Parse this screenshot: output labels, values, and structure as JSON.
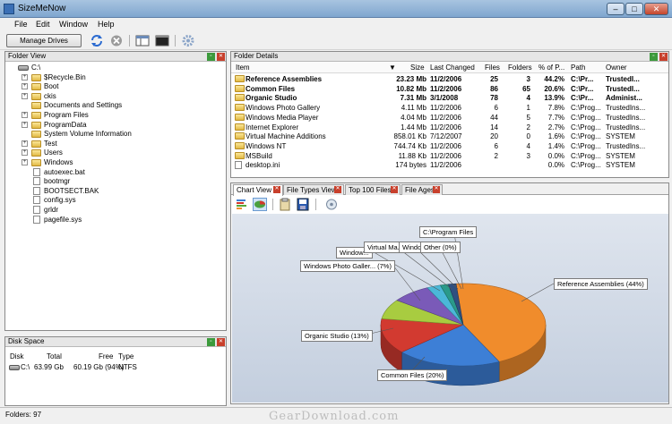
{
  "window": {
    "title": "SizeMeNow",
    "min_glyph": "–",
    "max_glyph": "□",
    "close_glyph": "✕"
  },
  "menu": [
    "File",
    "Edit",
    "Window",
    "Help"
  ],
  "toolbar": {
    "manage_drives": "Manage Drives"
  },
  "folder_view": {
    "title": "Folder View",
    "root": "C:\\",
    "items": [
      {
        "label": "$Recycle.Bin",
        "type": "folder",
        "expandable": true
      },
      {
        "label": "Boot",
        "type": "folder",
        "expandable": true
      },
      {
        "label": "ckis",
        "type": "folder",
        "expandable": true
      },
      {
        "label": "Documents and Settings",
        "type": "folder",
        "expandable": false
      },
      {
        "label": "Program Files",
        "type": "folder",
        "expandable": true
      },
      {
        "label": "ProgramData",
        "type": "folder",
        "expandable": true
      },
      {
        "label": "System Volume Information",
        "type": "folder",
        "expandable": false
      },
      {
        "label": "Test",
        "type": "folder",
        "expandable": true
      },
      {
        "label": "Users",
        "type": "folder",
        "expandable": true
      },
      {
        "label": "Windows",
        "type": "folder",
        "expandable": true
      },
      {
        "label": "autoexec.bat",
        "type": "file",
        "expandable": false
      },
      {
        "label": "bootmgr",
        "type": "file",
        "expandable": false
      },
      {
        "label": "BOOTSECT.BAK",
        "type": "file",
        "expandable": false
      },
      {
        "label": "config.sys",
        "type": "file",
        "expandable": false
      },
      {
        "label": "grldr",
        "type": "file",
        "expandable": false
      },
      {
        "label": "pagefile.sys",
        "type": "file",
        "expandable": false
      }
    ]
  },
  "disk_space": {
    "title": "Disk Space",
    "columns": [
      "Disk",
      "Total",
      "Free",
      "Type"
    ],
    "rows": [
      {
        "disk": "C:\\",
        "total": "63.99 Gb",
        "free": "60.19 Gb (94%)",
        "type": "NTFS"
      }
    ]
  },
  "folder_details": {
    "title": "Folder Details",
    "sort_glyph": "▼",
    "columns": [
      "Item",
      "Size",
      "Last Changed",
      "Files",
      "Folders",
      "% of P...",
      "Path",
      "Owner"
    ],
    "rows": [
      {
        "item": "Reference Assemblies",
        "size": "23.23 Mb",
        "changed": "11/2/2006",
        "files": "25",
        "folders": "3",
        "pct": "44.2%",
        "path": "C:\\Pr...",
        "owner": "TrustedI...",
        "bold": true
      },
      {
        "item": "Common Files",
        "size": "10.82 Mb",
        "changed": "11/2/2006",
        "files": "86",
        "folders": "65",
        "pct": "20.6%",
        "path": "C:\\Pr...",
        "owner": "TrustedI...",
        "bold": true
      },
      {
        "item": "Organic Studio",
        "size": "7.31 Mb",
        "changed": "3/1/2008",
        "files": "78",
        "folders": "4",
        "pct": "13.9%",
        "path": "C:\\Pr...",
        "owner": "Administ...",
        "bold": true
      },
      {
        "item": "Windows Photo Gallery",
        "size": "4.11 Mb",
        "changed": "11/2/2006",
        "files": "6",
        "folders": "1",
        "pct": "7.8%",
        "path": "C:\\Prog...",
        "owner": "TrustedIns...",
        "bold": false
      },
      {
        "item": "Windows Media Player",
        "size": "4.04 Mb",
        "changed": "11/2/2006",
        "files": "44",
        "folders": "5",
        "pct": "7.7%",
        "path": "C:\\Prog...",
        "owner": "TrustedIns...",
        "bold": false
      },
      {
        "item": "Internet Explorer",
        "size": "1.44 Mb",
        "changed": "11/2/2006",
        "files": "14",
        "folders": "2",
        "pct": "2.7%",
        "path": "C:\\Prog...",
        "owner": "TrustedIns...",
        "bold": false
      },
      {
        "item": "Virtual Machine Additions",
        "size": "858.01 Kb",
        "changed": "7/12/2007",
        "files": "20",
        "folders": "0",
        "pct": "1.6%",
        "path": "C:\\Prog...",
        "owner": "SYSTEM",
        "bold": false
      },
      {
        "item": "Windows NT",
        "size": "744.74 Kb",
        "changed": "11/2/2006",
        "files": "6",
        "folders": "4",
        "pct": "1.4%",
        "path": "C:\\Prog...",
        "owner": "TrustedIns...",
        "bold": false
      },
      {
        "item": "MSBuild",
        "size": "11.88 Kb",
        "changed": "11/2/2006",
        "files": "2",
        "folders": "3",
        "pct": "0.0%",
        "path": "C:\\Prog...",
        "owner": "SYSTEM",
        "bold": false
      },
      {
        "item": "desktop.ini",
        "size": "174 bytes",
        "changed": "11/2/2006",
        "files": "",
        "folders": "",
        "pct": "0.0%",
        "path": "C:\\Prog...",
        "owner": "SYSTEM",
        "bold": false,
        "file": true
      }
    ]
  },
  "tabs": [
    {
      "label": "Chart View",
      "active": true
    },
    {
      "label": "File Types View",
      "active": false
    },
    {
      "label": "Top 100 Files",
      "active": false
    },
    {
      "label": "File Ages",
      "active": false
    }
  ],
  "chart_data": {
    "type": "pie",
    "slices": [
      {
        "label": "Reference Assemblies (44%)",
        "value": 44.2,
        "color": "#f08c2c"
      },
      {
        "label": "Common Files (20%)",
        "value": 20.6,
        "color": "#3d7fd6"
      },
      {
        "label": "Organic Studio (13%)",
        "value": 13.9,
        "color": "#d23a30"
      },
      {
        "label": "Windows Photo Galler... (7%)",
        "value": 7.8,
        "color": "#a8cc40"
      },
      {
        "label": "Window...",
        "value": 7.7,
        "color": "#7a5ab8"
      },
      {
        "label": "Virtual Ma...",
        "value": 2.7,
        "color": "#4bb8d8"
      },
      {
        "label": "Windo...",
        "value": 1.6,
        "color": "#2a9a8a"
      },
      {
        "label": "Other (0%)",
        "value": 1.5,
        "color": "#305080"
      }
    ],
    "top_label": "C:\\Program Files"
  },
  "status": {
    "text": "Folders: 97"
  },
  "watermark": "GearDownload.com"
}
